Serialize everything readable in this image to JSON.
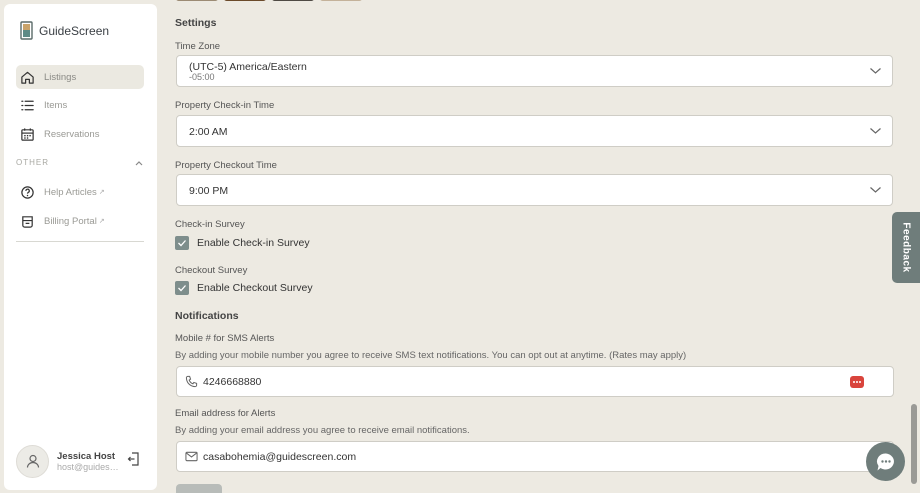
{
  "brand": {
    "name": "GuideScreen"
  },
  "sidebar": {
    "nav": [
      {
        "label": "Listings",
        "icon": "home-icon",
        "active": true
      },
      {
        "label": "Items",
        "icon": "list-icon"
      },
      {
        "label": "Reservations",
        "icon": "calendar-icon"
      }
    ],
    "section_label": "OTHER",
    "other": [
      {
        "label": "Help Articles",
        "icon": "help-circle-icon",
        "ext": "↗"
      },
      {
        "label": "Billing Portal",
        "icon": "billing-icon",
        "ext": "↗"
      }
    ],
    "user": {
      "name": "Jessica Host",
      "email": "host@guidescreen.com"
    }
  },
  "settings": {
    "heading": "Settings",
    "time_zone": {
      "label": "Time Zone",
      "value": "(UTC-5) America/Eastern",
      "sub": "-05:00"
    },
    "checkin_time": {
      "label": "Property Check-in Time",
      "value": "2:00 AM"
    },
    "checkout_time": {
      "label": "Property Checkout Time",
      "value": "9:00 PM"
    },
    "checkin_survey": {
      "label": "Check-in Survey",
      "checkbox_label": "Enable Check-in Survey",
      "checked": true
    },
    "checkout_survey": {
      "label": "Checkout Survey",
      "checkbox_label": "Enable Checkout Survey",
      "checked": true
    }
  },
  "notifications": {
    "heading": "Notifications",
    "sms": {
      "label": "Mobile # for SMS Alerts",
      "help": "By adding your mobile number you agree to receive SMS text notifications. You can opt out at anytime. (Rates may apply)",
      "value": "4246668880"
    },
    "email": {
      "label": "Email address for Alerts",
      "help": "By adding your email address you agree to receive email notifications.",
      "value": "casabohemia@guidescreen.com"
    }
  },
  "feedback_tab": "Feedback",
  "colors": {
    "accent": "#6f7d7b",
    "checkbox": "#7e8e8c",
    "active_nav": "#ebe9e1",
    "badge": "#d9443c"
  }
}
